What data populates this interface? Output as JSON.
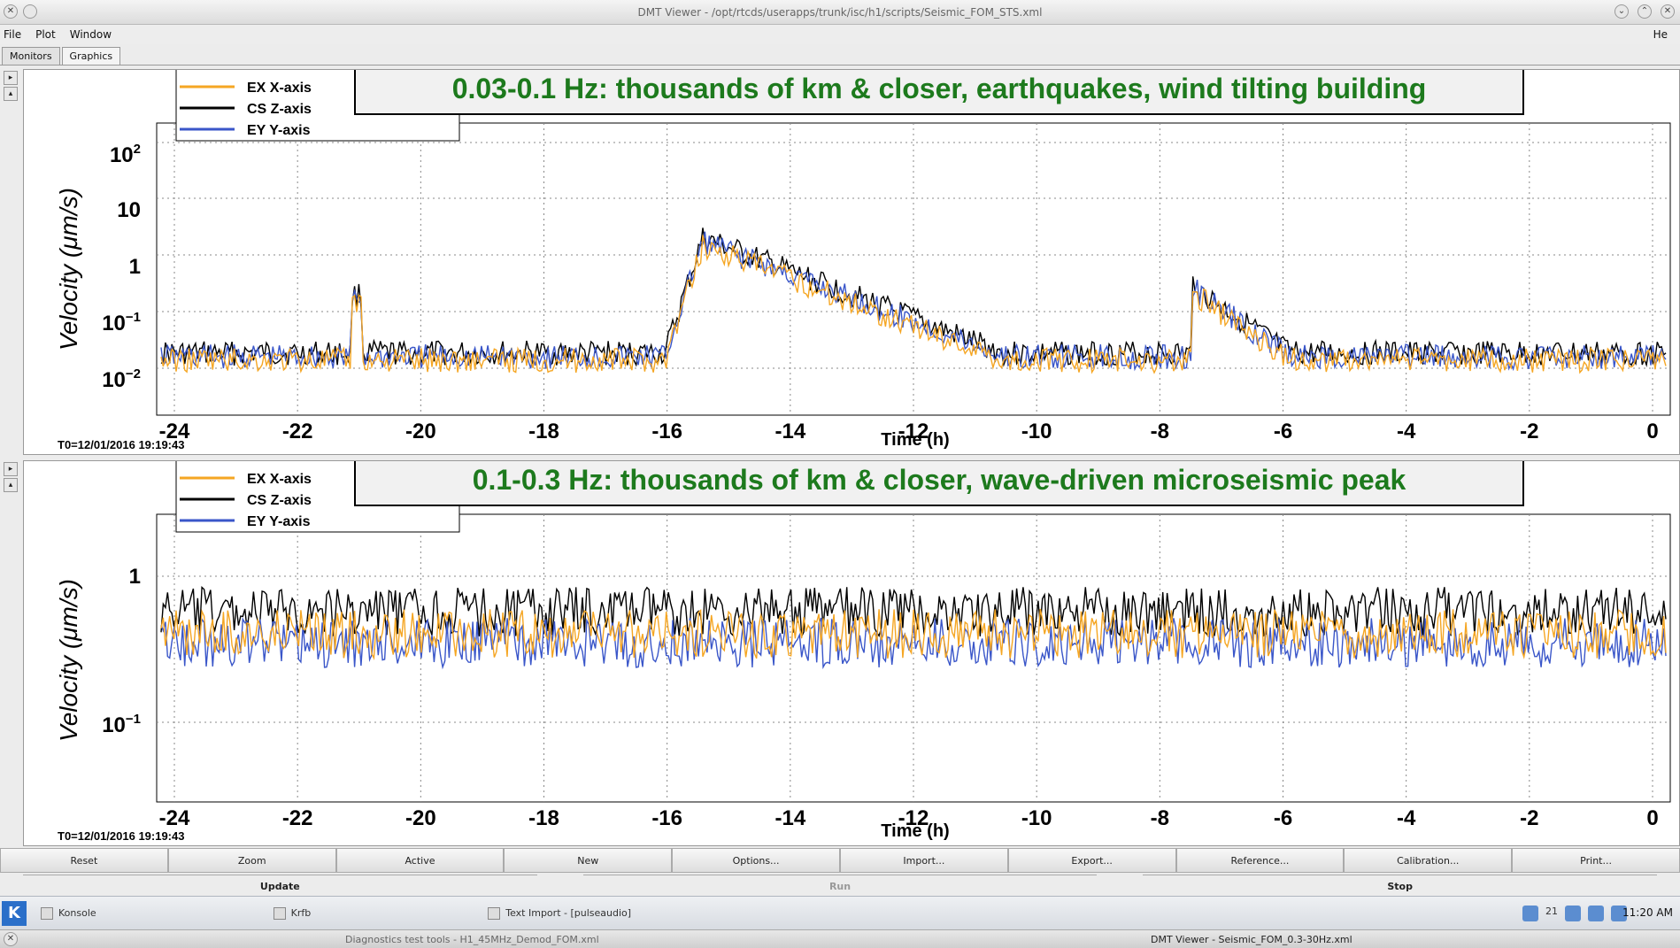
{
  "window": {
    "title": "DMT Viewer - /opt/rtcds/userapps/trunk/isc/h1/scripts/Seismic_FOM_STS.xml"
  },
  "menu": {
    "file": "File",
    "plot": "Plot",
    "window": "Window",
    "help": "He"
  },
  "tabs": {
    "monitors": "Monitors",
    "graphics": "Graphics"
  },
  "colors": {
    "ex": "#f5a623",
    "cs": "#000000",
    "ey": "#3a56c9",
    "banner_text": "#1d7a1d"
  },
  "plots": [
    {
      "banner": "0.03-0.1 Hz: thousands of km & closer, earthquakes, wind tilting building",
      "ylabel": "Velocity  (μm/s)",
      "xlabel": "Time (h)",
      "t0": "T0=12/01/2016 19:19:43",
      "legend": [
        "EX X-axis",
        "CS Z-axis",
        "EY Y-axis"
      ],
      "yticks": [
        {
          "base": "10",
          "exp": "2"
        },
        {
          "base": "10",
          "exp": ""
        },
        {
          "base": "1",
          "exp": ""
        },
        {
          "base": "10",
          "exp": "−1"
        },
        {
          "base": "10",
          "exp": "−2"
        }
      ],
      "xticks": [
        "-24",
        "-22",
        "-20",
        "-18",
        "-16",
        "-14",
        "-12",
        "-10",
        "-8",
        "-6",
        "-4",
        "-2",
        "0"
      ]
    },
    {
      "banner": "0.1-0.3 Hz: thousands of km & closer, wave-driven microseismic peak",
      "ylabel": "Velocity  (μm/s)",
      "xlabel": "Time (h)",
      "t0": "T0=12/01/2016 19:19:43",
      "legend": [
        "EX X-axis",
        "CS Z-axis",
        "EY Y-axis"
      ],
      "yticks": [
        {
          "base": "1",
          "exp": ""
        },
        {
          "base": "10",
          "exp": "−1"
        }
      ],
      "xticks": [
        "-24",
        "-22",
        "-20",
        "-18",
        "-16",
        "-14",
        "-12",
        "-10",
        "-8",
        "-6",
        "-4",
        "-2",
        "0"
      ]
    }
  ],
  "toolbar": [
    "Reset",
    "Zoom",
    "Active",
    "New",
    "Options...",
    "Import...",
    "Export...",
    "Reference...",
    "Calibration...",
    "Print..."
  ],
  "toolbar2": [
    "Update",
    "Run",
    "Stop"
  ],
  "taskbar": {
    "tasks": [
      "Konsole",
      "Krfb",
      "Text Import - [pulseaudio]"
    ],
    "clock": "11:20 AM",
    "tray_badge": "21"
  },
  "bottombar": {
    "left": "Diagnostics test tools - H1_45MHz_Demod_FOM.xml",
    "right": "DMT Viewer - Seismic_FOM_0.3-30Hz.xml"
  }
}
